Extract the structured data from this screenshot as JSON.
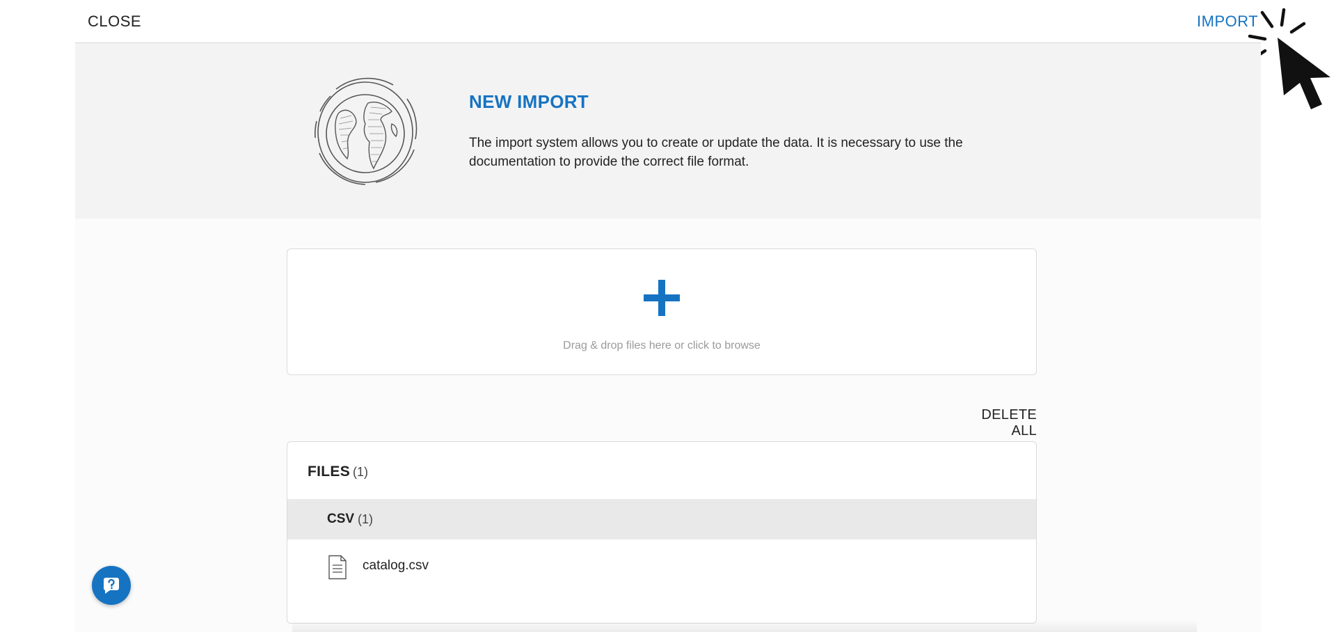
{
  "colors": {
    "accent": "#1673c2"
  },
  "topbar": {
    "close_label": "CLOSE",
    "import_label": "IMPORT"
  },
  "hero": {
    "title": "NEW IMPORT",
    "description": "The import system allows you to create or update the data. It is necessary to use the documentation to provide the correct file format."
  },
  "dropzone": {
    "hint": "Drag & drop files here or click to browse",
    "icon": "plus-icon"
  },
  "actions": {
    "delete_all_label": "DELETE ALL"
  },
  "files": {
    "label": "FILES",
    "count": "(1)",
    "groups": [
      {
        "label": "CSV",
        "count": "(1)",
        "items": [
          {
            "name": "catalog.csv",
            "icon": "document-icon"
          }
        ]
      }
    ]
  },
  "help": {
    "icon": "help-chat-icon"
  }
}
